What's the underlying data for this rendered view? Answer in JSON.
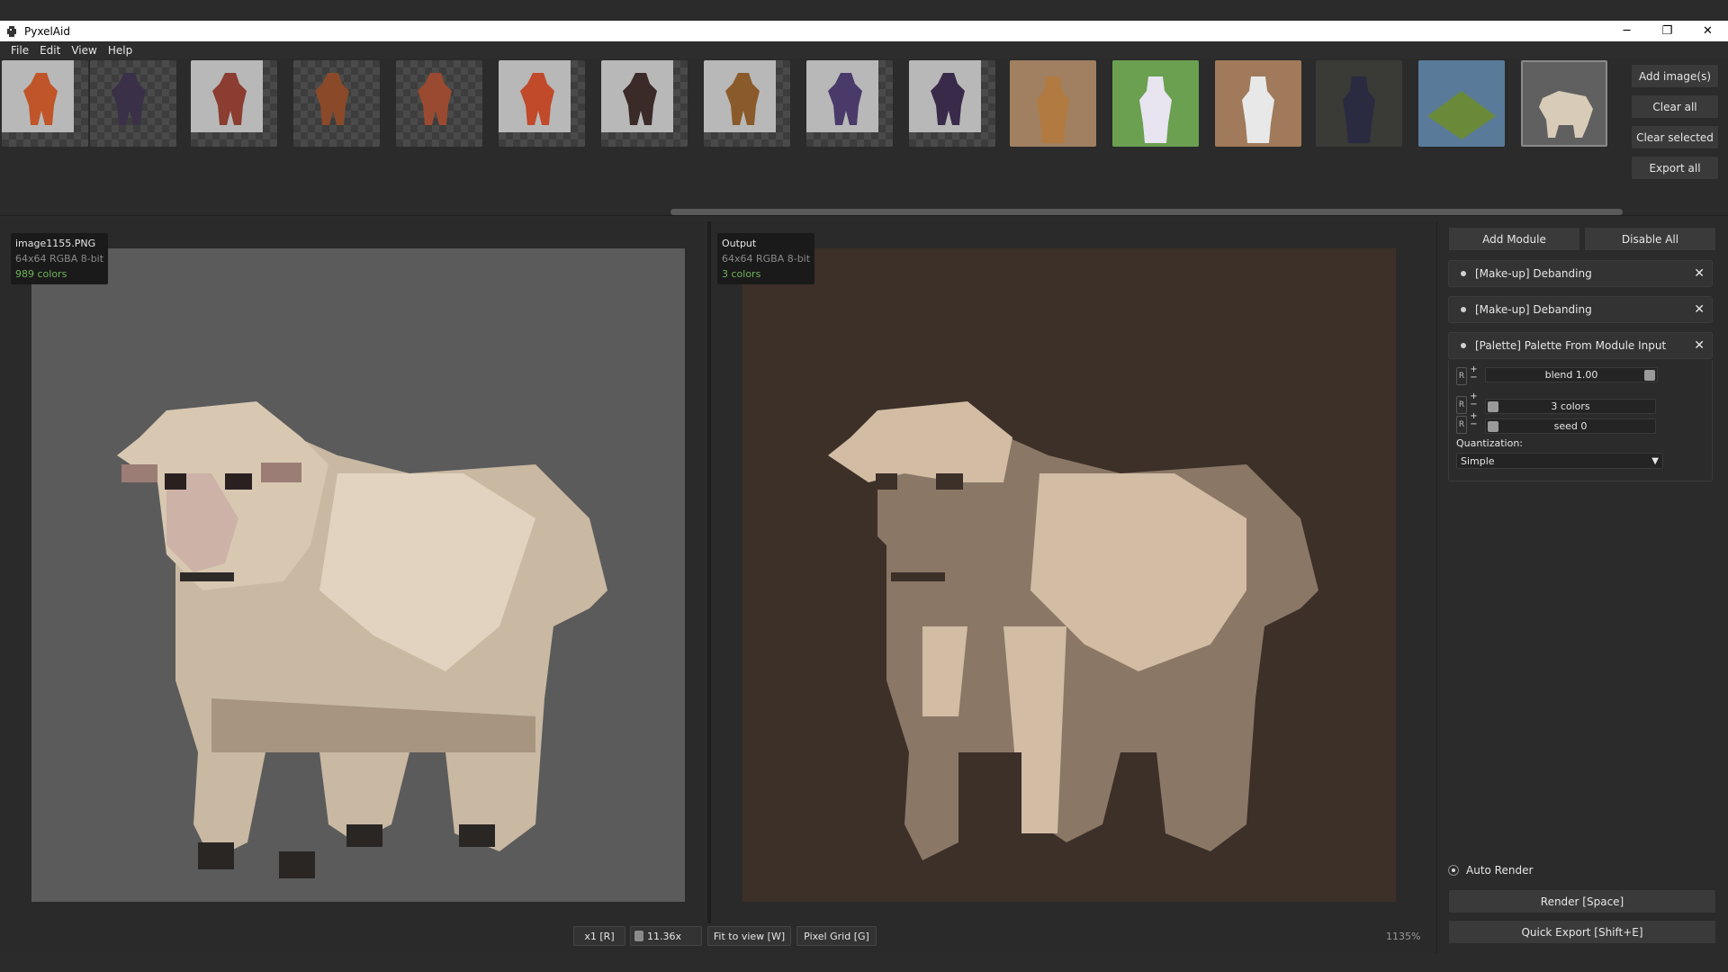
{
  "window": {
    "title": "PyxelAid",
    "minimize": "─",
    "maximize": "❐",
    "close": "✕"
  },
  "menu": [
    "File",
    "Edit",
    "View",
    "Help"
  ],
  "gallery": {
    "thumbnails": [
      {
        "name": "thumb-1",
        "kind": "sprite"
      },
      {
        "name": "thumb-2",
        "kind": "sprite"
      },
      {
        "name": "thumb-3",
        "kind": "sprite"
      },
      {
        "name": "thumb-4",
        "kind": "sprite"
      },
      {
        "name": "thumb-5",
        "kind": "sprite"
      },
      {
        "name": "thumb-6",
        "kind": "sprite"
      },
      {
        "name": "thumb-7",
        "kind": "sprite"
      },
      {
        "name": "thumb-8",
        "kind": "sprite"
      },
      {
        "name": "thumb-9",
        "kind": "sprite"
      },
      {
        "name": "thumb-10",
        "kind": "sprite"
      },
      {
        "name": "thumb-11",
        "kind": "art"
      },
      {
        "name": "thumb-12",
        "kind": "art"
      },
      {
        "name": "thumb-13",
        "kind": "art"
      },
      {
        "name": "thumb-14",
        "kind": "art"
      },
      {
        "name": "thumb-15",
        "kind": "art"
      },
      {
        "name": "thumb-16",
        "kind": "art",
        "selected": true
      }
    ],
    "buttons": {
      "add_images": "Add image(s)",
      "clear_all": "Clear all",
      "clear_selected": "Clear selected",
      "export_all": "Export all"
    }
  },
  "input": {
    "filename": "image1155.PNG",
    "meta": "64x64  RGBA  8-bit",
    "colors": "989 colors",
    "bg_color": "#5b5b5b"
  },
  "output": {
    "filename": "Output",
    "meta": "64x64  RGBA  8-bit",
    "colors": "3 colors",
    "bg_color": "#3d3029"
  },
  "viewbar": {
    "scale": "x1 [R]",
    "zoom": "11.36x",
    "fit": "Fit to view [W]",
    "grid": "Pixel Grid [G]",
    "zoom_percent": "1135%"
  },
  "modules_panel": {
    "add_module": "Add Module",
    "disable_all": "Disable All",
    "modules": [
      {
        "label": "[Make-up] Debanding"
      },
      {
        "label": "[Make-up] Debanding"
      },
      {
        "label": "[Palette] Palette From Module Input"
      }
    ],
    "params": {
      "r_label": "R",
      "plus": "+",
      "minus": "−",
      "blend": "blend 1.00",
      "colors": "3 colors",
      "seed": "seed 0",
      "quantization_label": "Quantization:",
      "quantization_value": "Simple"
    },
    "auto_render": "Auto Render",
    "render": "Render  [Space]",
    "quick_export": "Quick Export  [Shift+E]"
  },
  "palette": {
    "out_dark": "#3d3029",
    "out_mid": "#8a7766",
    "out_light": "#d2bca4",
    "accent_green": "#6fb35a"
  }
}
